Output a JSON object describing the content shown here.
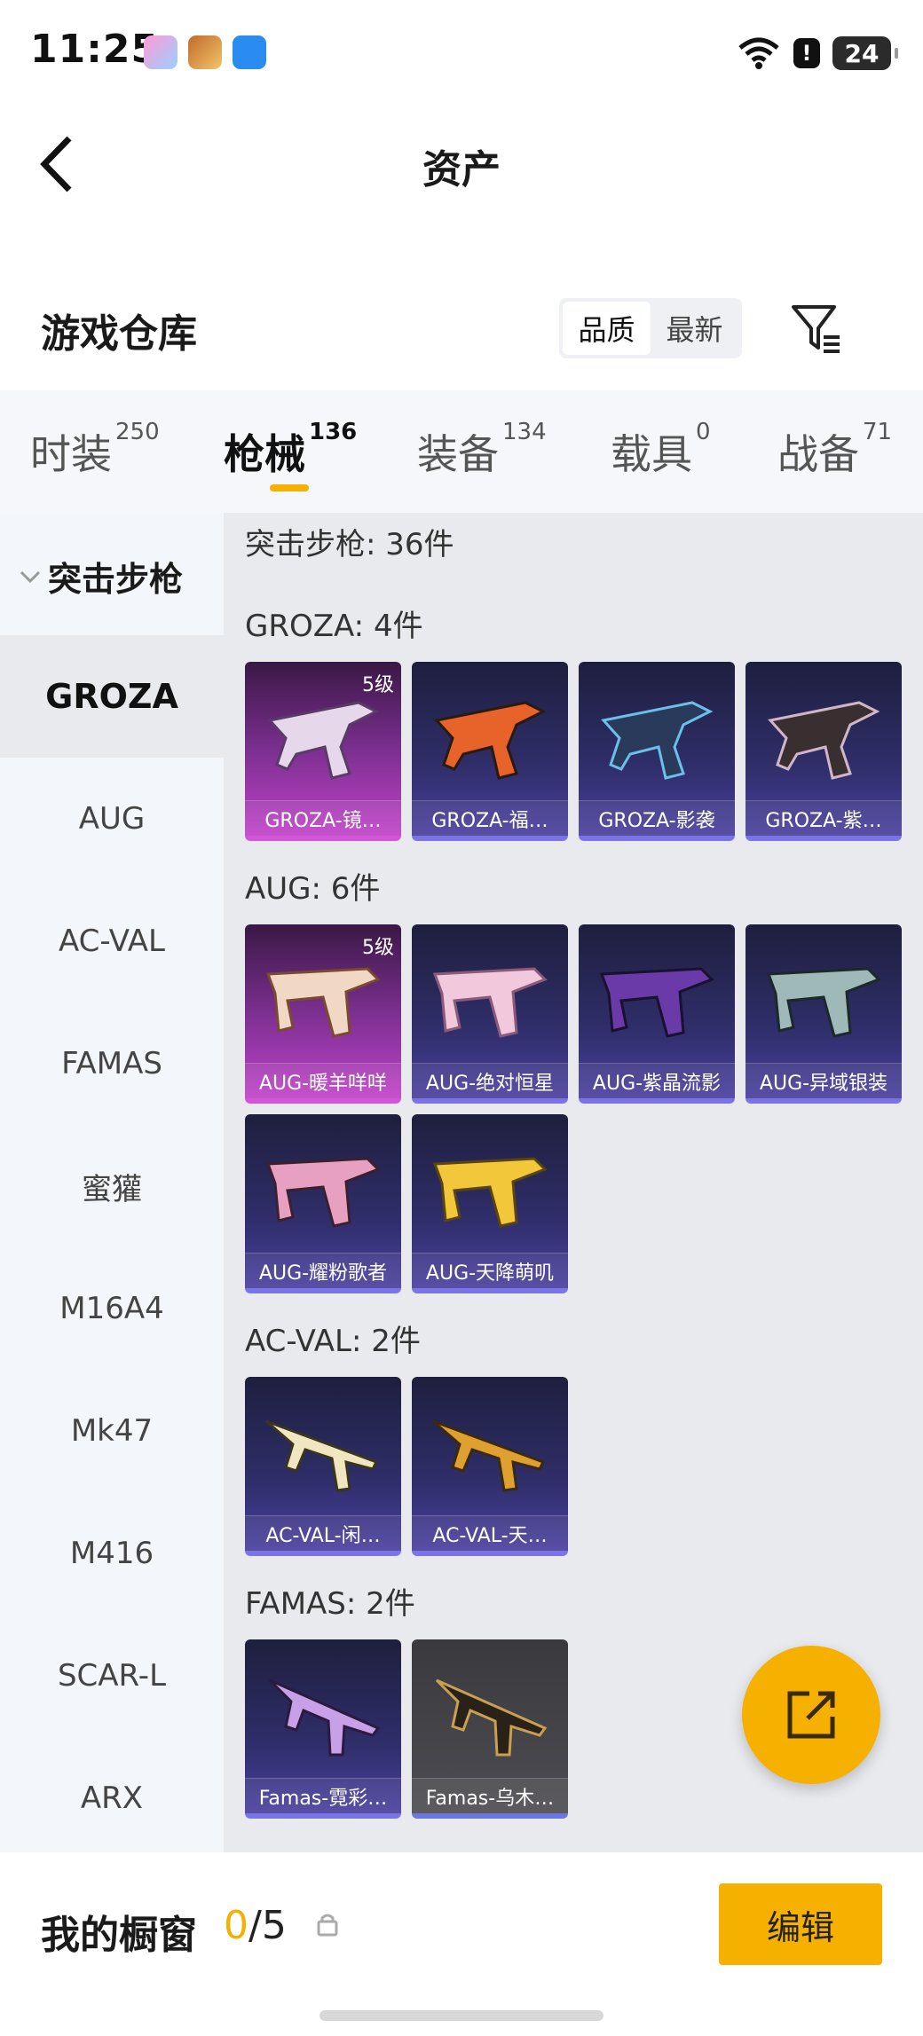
{
  "status_bar": {
    "time": "11:25",
    "battery": "24"
  },
  "nav": {
    "title": "资产"
  },
  "warehouse": {
    "title": "游戏仓库",
    "sort_options": [
      "品质",
      "最新"
    ],
    "sort_selected": "品质"
  },
  "tabs": [
    {
      "label": "时装",
      "count": "250"
    },
    {
      "label": "枪械",
      "count": "136"
    },
    {
      "label": "装备",
      "count": "134"
    },
    {
      "label": "载具",
      "count": "0"
    },
    {
      "label": "战备",
      "count": "71"
    }
  ],
  "sidebar": {
    "group": "突击步枪",
    "items": [
      "GROZA",
      "AUG",
      "AC-VAL",
      "FAMAS",
      "蜜獾",
      "M16A4",
      "Mk47",
      "M416",
      "SCAR-L",
      "ARX"
    ]
  },
  "content": {
    "summary": "突击步枪: 36件",
    "sections": [
      {
        "title": "GROZA: 4件",
        "items": [
          {
            "name": "GROZA-镜…",
            "level": "5级"
          },
          {
            "name": "GROZA-福…"
          },
          {
            "name": "GROZA-影袭"
          },
          {
            "name": "GROZA-紫…"
          }
        ]
      },
      {
        "title": "AUG: 6件",
        "items": [
          {
            "name": "AUG-暖羊咩咩",
            "level": "5级"
          },
          {
            "name": "AUG-绝对恒星"
          },
          {
            "name": "AUG-紫晶流影"
          },
          {
            "name": "AUG-异域银装"
          },
          {
            "name": "AUG-耀粉歌者"
          },
          {
            "name": "AUG-天降萌叽"
          }
        ]
      },
      {
        "title": "AC-VAL: 2件",
        "items": [
          {
            "name": "AC-VAL-闲…"
          },
          {
            "name": "AC-VAL-天…"
          }
        ]
      },
      {
        "title": "FAMAS: 2件",
        "items": [
          {
            "name": "Famas-霓彩…"
          },
          {
            "name": "Famas-乌木…"
          }
        ]
      }
    ]
  },
  "showcase": {
    "label": "我的橱窗",
    "current": "0",
    "total": "/5",
    "edit_label": "编辑"
  },
  "colors": {
    "accent": "#f5b000",
    "card_purple": "#2f2e6a",
    "card_pink": "#c043c8"
  }
}
